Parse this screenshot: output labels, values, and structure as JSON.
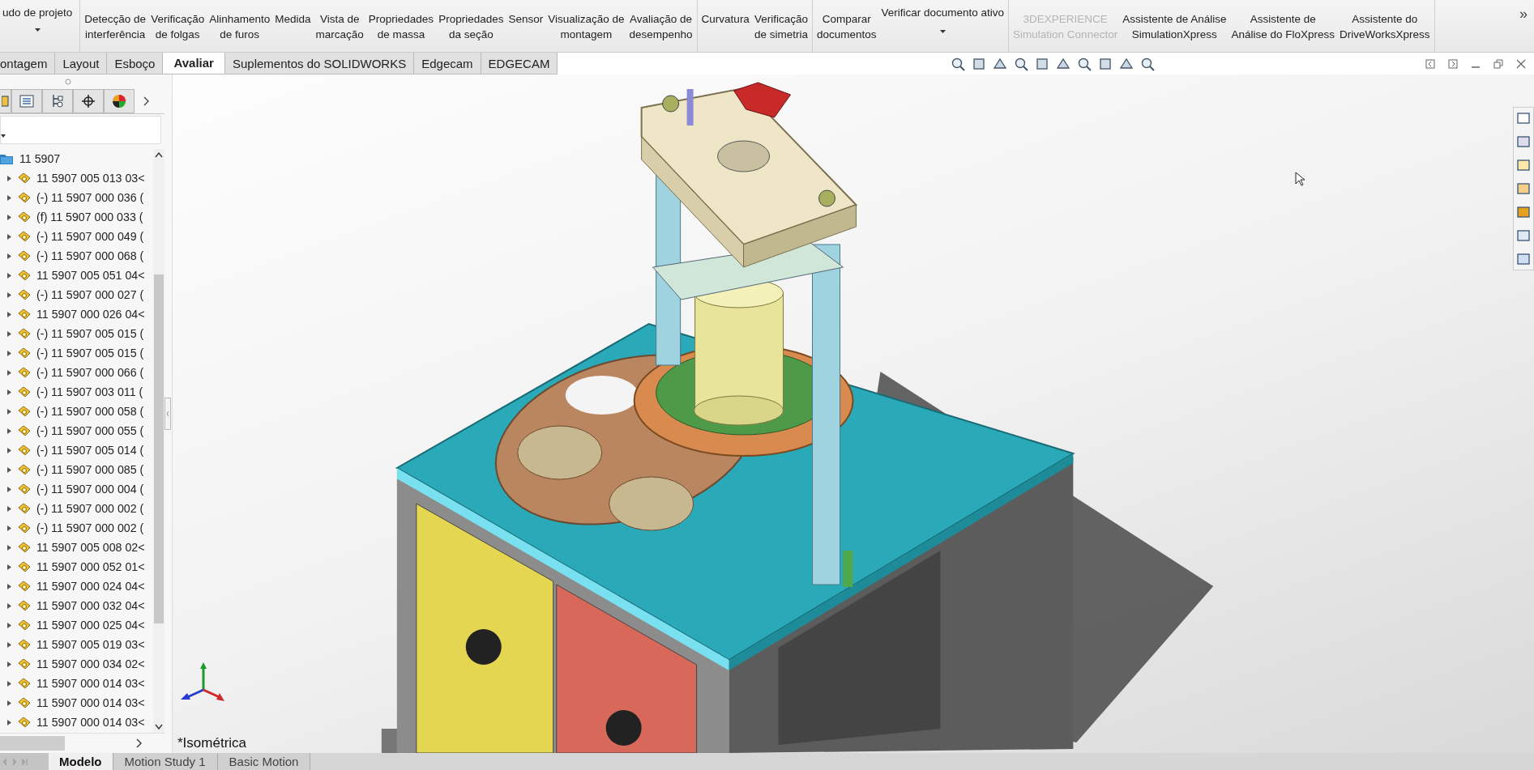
{
  "ribbon": {
    "groups": [
      {
        "items": [
          {
            "lines": [
              "udo de projeto"
            ],
            "dropdown": true,
            "disabled": false
          }
        ]
      },
      {
        "items": [
          {
            "lines": [
              "Detecção de",
              "interferência"
            ],
            "dropdown": false,
            "disabled": false
          },
          {
            "lines": [
              "Verificação",
              "de folgas"
            ],
            "dropdown": false,
            "disabled": false
          },
          {
            "lines": [
              "Alinhamento",
              "de furos"
            ],
            "dropdown": false,
            "disabled": false
          },
          {
            "lines": [
              "Medida"
            ],
            "dropdown": false,
            "disabled": false
          },
          {
            "lines": [
              "Vista de",
              "marcação"
            ],
            "dropdown": false,
            "disabled": false
          },
          {
            "lines": [
              "Propriedades",
              "de massa"
            ],
            "dropdown": false,
            "disabled": false
          },
          {
            "lines": [
              "Propriedades",
              "da seção"
            ],
            "dropdown": false,
            "disabled": false
          },
          {
            "lines": [
              "Sensor"
            ],
            "dropdown": false,
            "disabled": false
          },
          {
            "lines": [
              "Visualização de",
              "montagem"
            ],
            "dropdown": false,
            "disabled": false
          },
          {
            "lines": [
              "Avaliação de",
              "desempenho"
            ],
            "dropdown": false,
            "disabled": false
          }
        ]
      },
      {
        "items": [
          {
            "lines": [
              "Curvatura"
            ],
            "dropdown": false,
            "disabled": false
          },
          {
            "lines": [
              "Verificação",
              "de simetria"
            ],
            "dropdown": false,
            "disabled": false
          }
        ]
      },
      {
        "items": [
          {
            "lines": [
              "Comparar",
              "documentos"
            ],
            "dropdown": false,
            "disabled": false
          },
          {
            "lines": [
              "Verificar documento ativo"
            ],
            "dropdown": true,
            "disabled": false
          }
        ]
      },
      {
        "items": [
          {
            "lines": [
              "3DEXPERIENCE",
              "Simulation Connector"
            ],
            "dropdown": false,
            "disabled": true
          },
          {
            "lines": [
              "Assistente de Análise",
              "SimulationXpress"
            ],
            "dropdown": false,
            "disabled": false
          },
          {
            "lines": [
              "Assistente de",
              "Análise do FloXpress"
            ],
            "dropdown": false,
            "disabled": false
          },
          {
            "lines": [
              "Assistente do",
              "DriveWorksXpress"
            ],
            "dropdown": false,
            "disabled": false
          }
        ]
      }
    ],
    "overflow": "»"
  },
  "tabs": [
    {
      "label": "ontagem",
      "selected": false
    },
    {
      "label": "Layout",
      "selected": false
    },
    {
      "label": "Esboço",
      "selected": false
    },
    {
      "label": "Avaliar",
      "selected": true
    },
    {
      "label": "Suplementos do SOLIDWORKS",
      "selected": false
    },
    {
      "label": "Edgecam",
      "selected": false
    },
    {
      "label": "EDGECAM",
      "selected": false
    }
  ],
  "feature_tree": {
    "label": "11 5907",
    "children": [
      {
        "label": "11 5907 005 013 03<",
        "expanded": false
      },
      {
        "label": "(-) 11 5907 000 036 (",
        "expanded": false
      },
      {
        "label": "(f) 11 5907 000 033 (",
        "expanded": false
      },
      {
        "label": "(-) 11 5907 000 049 (",
        "expanded": false
      },
      {
        "label": "(-) 11 5907 000 068 (",
        "expanded": false
      },
      {
        "label": "11 5907 005 051 04<",
        "expanded": false
      },
      {
        "label": "(-) 11 5907 000 027 (",
        "expanded": false
      },
      {
        "label": "11 5907 000 026 04<",
        "expanded": false
      },
      {
        "label": "(-) 11 5907 005 015 (",
        "expanded": false
      },
      {
        "label": "(-) 11 5907 005 015 (",
        "expanded": false
      },
      {
        "label": "(-) 11 5907 000 066 (",
        "expanded": false
      },
      {
        "label": "(-) 11 5907 003 011 (",
        "expanded": false
      },
      {
        "label": "(-) 11 5907 000 058 (",
        "expanded": false
      },
      {
        "label": "(-) 11 5907 000 055 (",
        "expanded": false
      },
      {
        "label": "(-) 11 5907 005 014 (",
        "expanded": false
      },
      {
        "label": "(-) 11 5907 000 085 (",
        "expanded": false
      },
      {
        "label": "(-) 11 5907 000 004 (",
        "expanded": false
      },
      {
        "label": "(-) 11 5907 000 002 (",
        "expanded": false
      },
      {
        "label": "(-) 11 5907 000 002 (",
        "expanded": false
      },
      {
        "label": "11 5907 005 008 02<",
        "expanded": false
      },
      {
        "label": "11 5907 000 052 01<",
        "expanded": false
      },
      {
        "label": "11 5907 000 024 04<",
        "expanded": false
      },
      {
        "label": "11 5907 000 032 04<",
        "expanded": false
      },
      {
        "label": "11 5907 000 025 04<",
        "expanded": false
      },
      {
        "label": "11 5907 005 019 03<",
        "expanded": false
      },
      {
        "label": "11 5907 000 034 02<",
        "expanded": false
      },
      {
        "label": "11 5907 000 014 03<",
        "expanded": false
      },
      {
        "label": "11 5907 000 014 03<",
        "expanded": false
      },
      {
        "label": "11 5907 000 014 03<",
        "expanded": false
      }
    ]
  },
  "viewport": {
    "view_name": "*Isométrica"
  },
  "bottom_tabs": [
    {
      "label": "Modelo",
      "selected": true
    },
    {
      "label": "Motion Study 1",
      "selected": false
    },
    {
      "label": "Basic Motion",
      "selected": false
    }
  ]
}
